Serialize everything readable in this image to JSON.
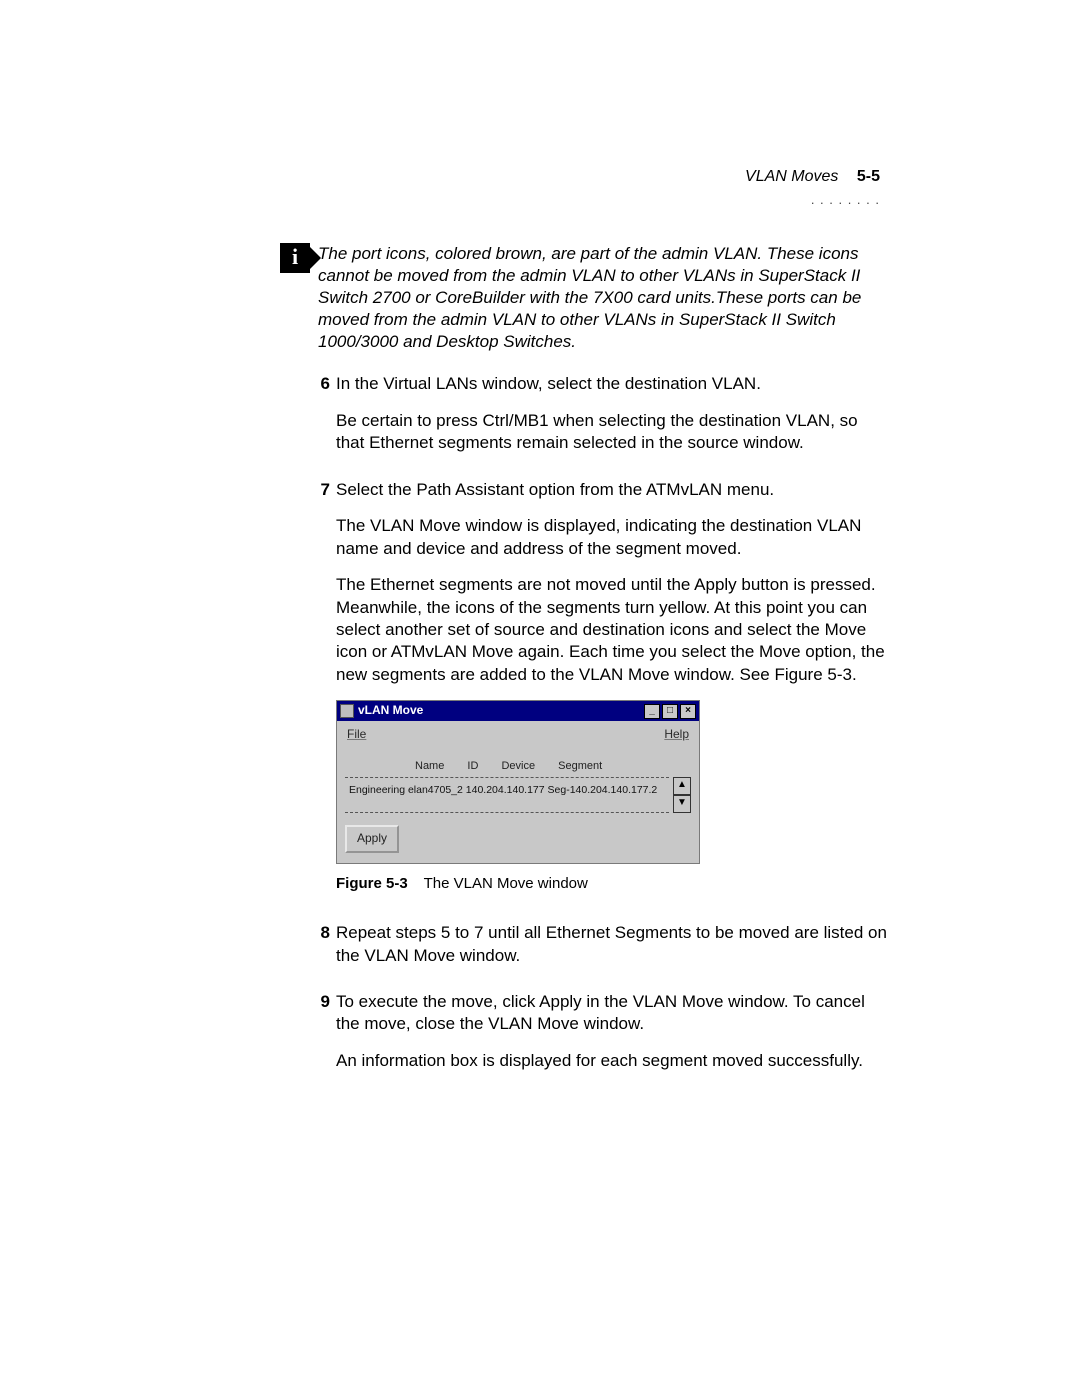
{
  "header": {
    "section": "VLAN Moves",
    "pagenum": "5-5",
    "dots": ". . . . . . . ."
  },
  "info_icon_label": "i",
  "note": "The port icons, colored brown, are part of the admin VLAN. These icons cannot be moved from the admin VLAN to other VLANs in SuperStack II Switch 2700 or CoreBuilder with the 7X00 card units.These ports can be moved from the admin VLAN to other VLANs in SuperStack II Switch 1000/3000 and Desktop Switches.",
  "steps": {
    "s6": {
      "num": "6",
      "lead": "In the Virtual LANs window, select the destination VLAN.",
      "p1": "Be certain to press Ctrl/MB1 when selecting the destination VLAN, so that Ethernet segments remain selected in the source window."
    },
    "s7": {
      "num": "7",
      "lead": "Select the Path Assistant option from the ATMvLAN menu.",
      "p1": "The VLAN Move window is displayed, indicating the destination VLAN name and device and address of the segment moved.",
      "p2": "The Ethernet segments are not moved until the Apply button is pressed. Meanwhile, the icons of the segments turn yellow. At this point you can select another set of source and destination icons and select the Move icon or ATMvLAN Move again. Each time you select the Move option, the new segments are added to the VLAN Move window. See Figure 5-3."
    },
    "s8": {
      "num": "8",
      "lead": "Repeat steps 5 to 7 until all Ethernet Segments to be moved are listed on the VLAN Move window."
    },
    "s9": {
      "num": "9",
      "lead": "To execute the move, click Apply in the VLAN Move window. To cancel the move, close the VLAN Move window.",
      "p1": "An information box is displayed for each segment moved successfully."
    }
  },
  "figure": {
    "num": "Figure 5-3",
    "caption": "The VLAN Move window"
  },
  "window": {
    "title": "vLAN Move",
    "menu_file": "File",
    "menu_help": "Help",
    "col_name": "Name",
    "col_id": "ID",
    "col_device": "Device",
    "col_segment": "Segment",
    "row": "Engineering  elan4705_2  140.204.140.177 Seg-140.204.140.177.2",
    "btn_min": "_",
    "btn_max": "□",
    "btn_close": "×",
    "sb_up": "▲",
    "sb_down": "▼",
    "apply": "Apply"
  }
}
